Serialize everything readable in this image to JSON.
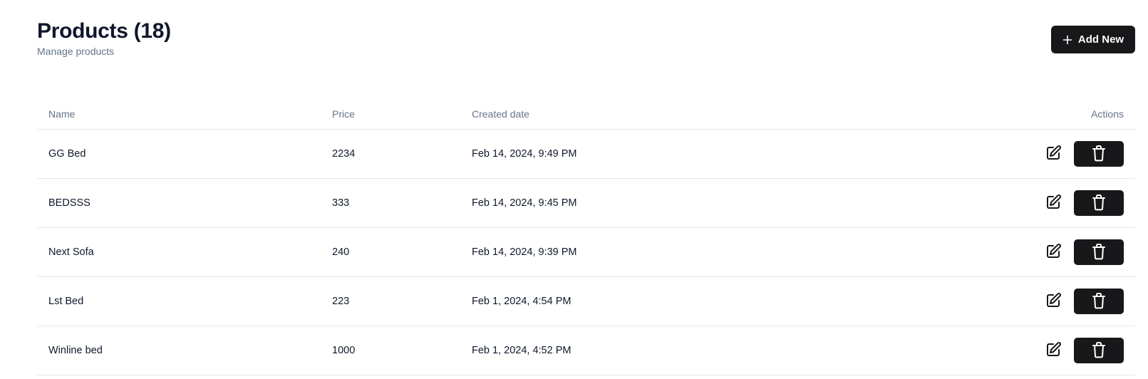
{
  "header": {
    "title": "Products (18)",
    "subtitle": "Manage products",
    "add_button_label": "Add New",
    "add_icon": "plus-icon"
  },
  "table": {
    "columns": [
      "Name",
      "Price",
      "Created date",
      "Actions"
    ],
    "rows": [
      {
        "name": "GG Bed",
        "price": "2234",
        "created": "Feb 14, 2024, 9:49 PM"
      },
      {
        "name": "BEDSSS",
        "price": "333",
        "created": "Feb 14, 2024, 9:45 PM"
      },
      {
        "name": "Next Sofa",
        "price": "240",
        "created": "Feb 14, 2024, 9:39 PM"
      },
      {
        "name": "Lst Bed",
        "price": "223",
        "created": "Feb 1, 2024, 4:54 PM"
      },
      {
        "name": "Winline bed",
        "price": "1000",
        "created": "Feb 1, 2024, 4:52 PM"
      }
    ],
    "edit_icon": "edit-icon",
    "delete_icon": "trash-icon"
  },
  "colors": {
    "primary_button": "#18181b",
    "muted_text": "#64748b",
    "border": "#e5e7eb",
    "text": "#0f172a"
  }
}
